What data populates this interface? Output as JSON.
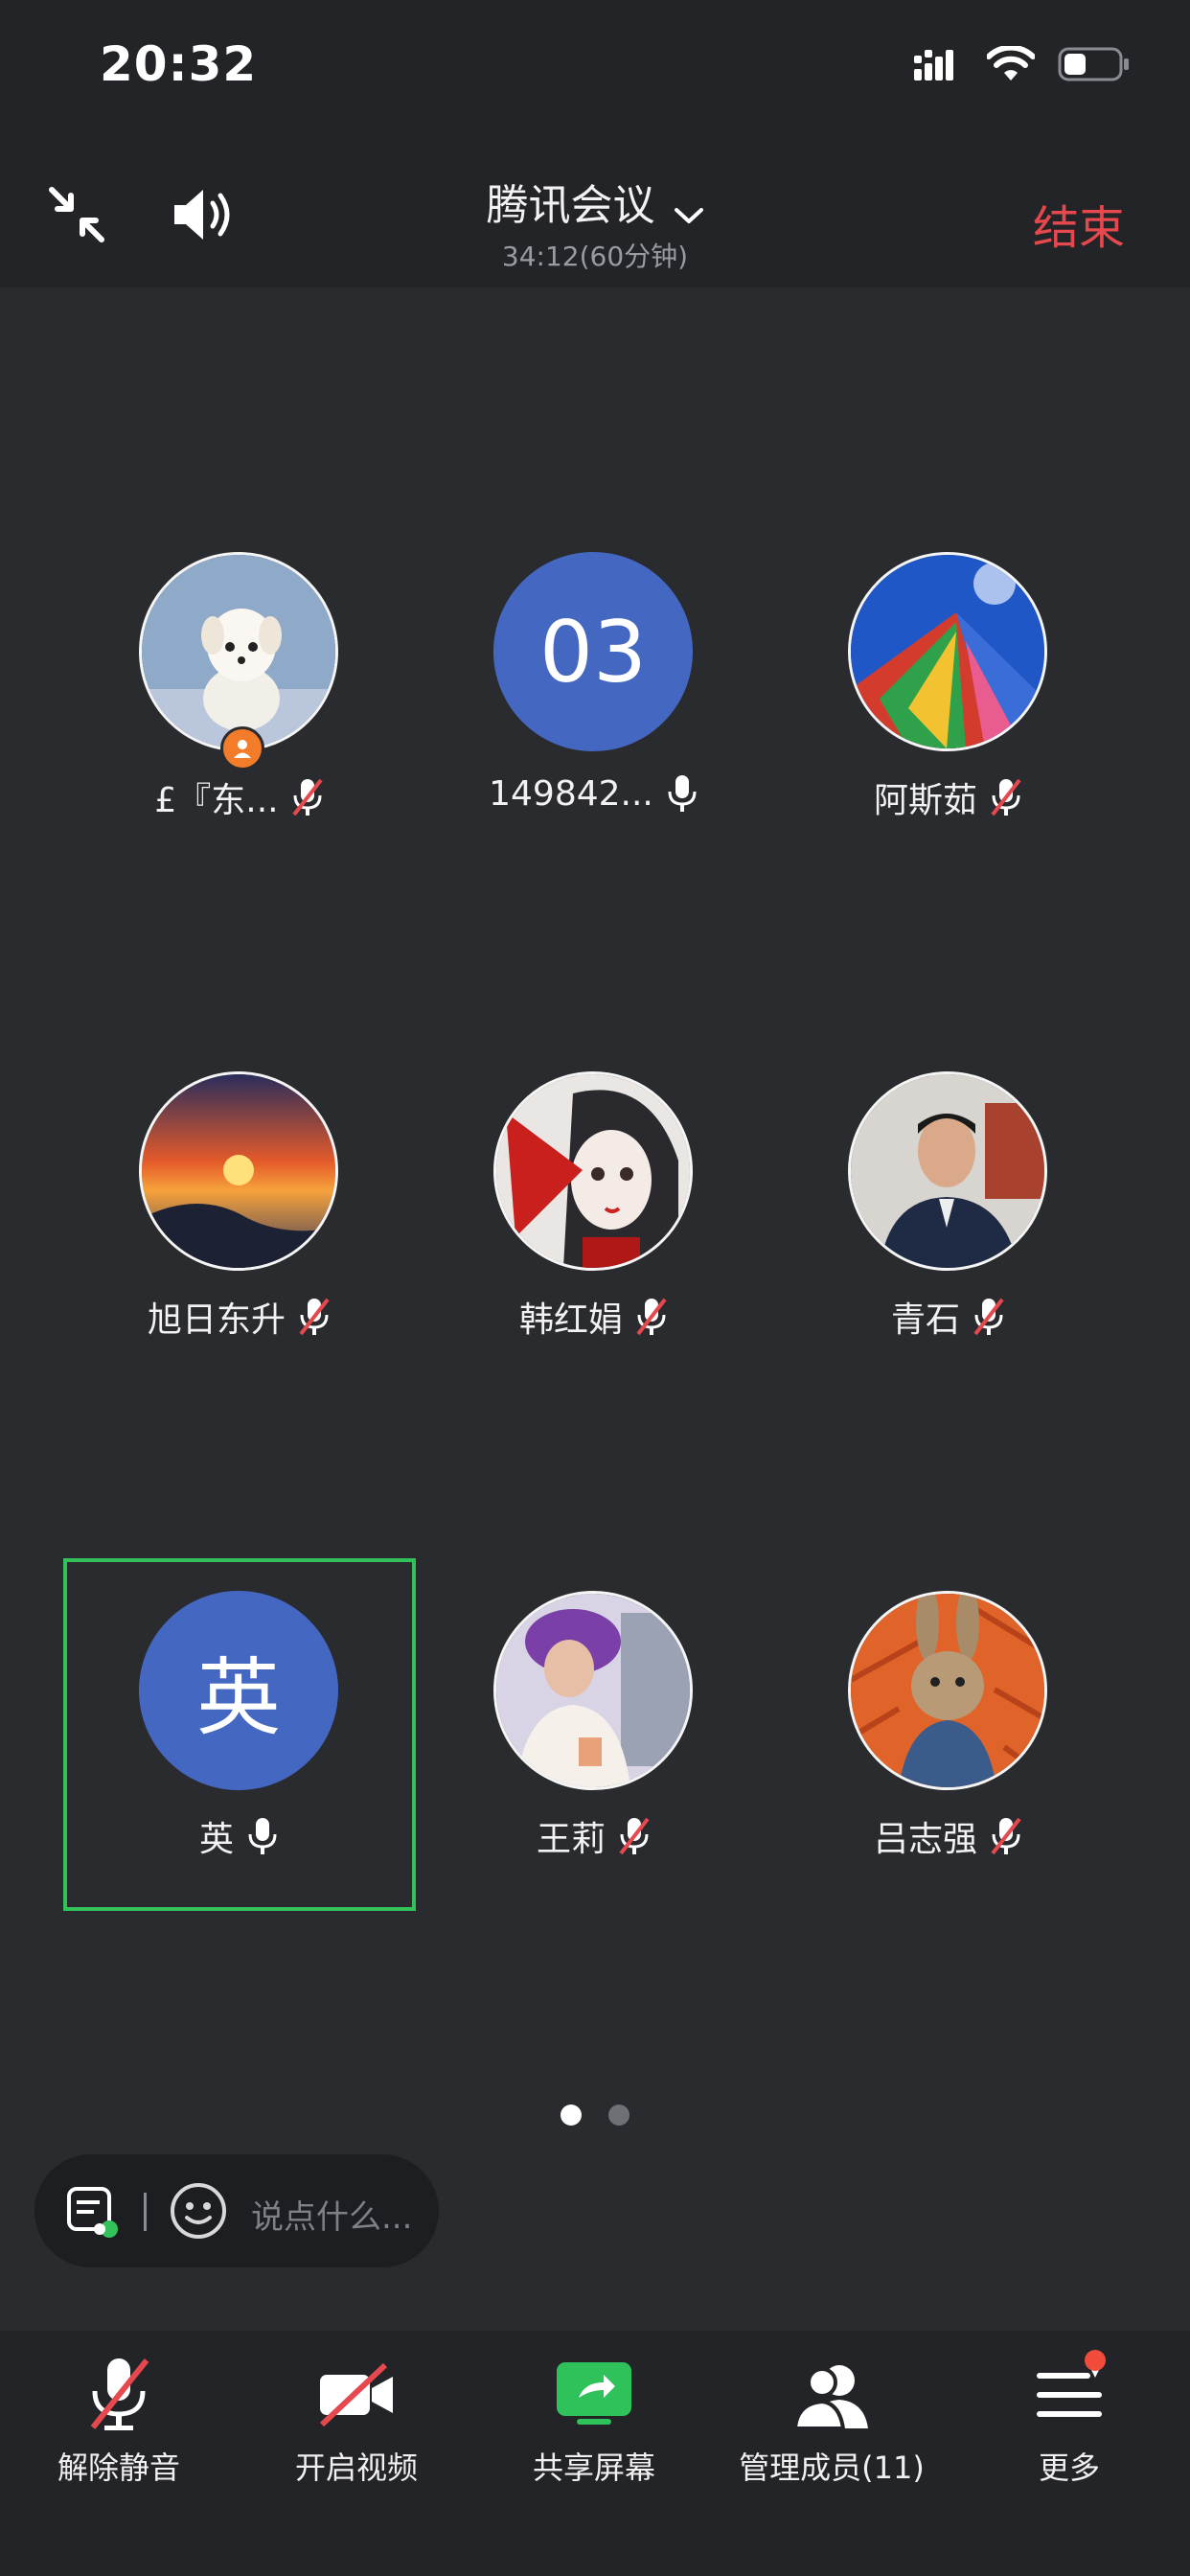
{
  "status_bar": {
    "time": "20:32",
    "icons": [
      "signal-icon",
      "wifi-icon",
      "battery-icon"
    ]
  },
  "header": {
    "title": "腾讯会议",
    "subtitle": "34:12(60分钟)",
    "end_label": "结束",
    "icons": [
      "shrink-icon",
      "speaker-icon",
      "chevron-down-icon"
    ]
  },
  "participants": [
    {
      "name": "£『东...",
      "muted": true,
      "host": true,
      "avatar": "photo-puppy"
    },
    {
      "name": "149842...",
      "muted": false,
      "avatar_letter": "03"
    },
    {
      "name": "阿斯茹",
      "muted": true,
      "avatar": "photo-prayer-flags"
    },
    {
      "name": "旭日东升",
      "muted": true,
      "avatar": "photo-sunset"
    },
    {
      "name": "韩红娟",
      "muted": true,
      "avatar": "photo-illustrated-girl"
    },
    {
      "name": "青石",
      "muted": true,
      "avatar": "photo-man"
    },
    {
      "name": "英",
      "muted": false,
      "avatar_letter": "英",
      "speaking": true
    },
    {
      "name": "王莉",
      "muted": true,
      "avatar": "photo-woman"
    },
    {
      "name": "吕志强",
      "muted": true,
      "avatar": "photo-rabbit"
    }
  ],
  "pagination": {
    "current": 1,
    "total": 2
  },
  "chat": {
    "placeholder": "说点什么..."
  },
  "toolbar": {
    "unmute": "解除静音",
    "start_video": "开启视频",
    "share_screen": "共享屏幕",
    "manage_members": "管理成员(11)",
    "more": "更多"
  },
  "colors": {
    "background": "#2a2b2f",
    "bar": "#232427",
    "accent_red": "#e5484d",
    "avatar_blue": "#4468c2",
    "speaking_green": "#33c159",
    "share_green": "#2fc15a"
  }
}
